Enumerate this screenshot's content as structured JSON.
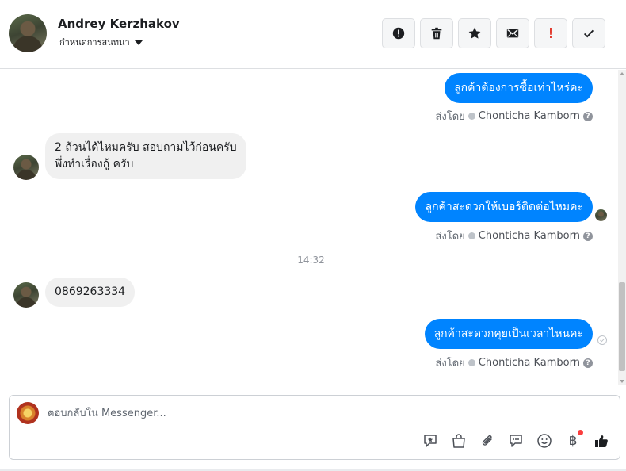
{
  "header": {
    "contact_name": "Andrey Kerzhakov",
    "status_label": "กำหนดการสนทนา",
    "actions": [
      {
        "icon": "alert-circle-icon",
        "name": "mark-spam-button"
      },
      {
        "icon": "trash-icon",
        "name": "delete-button"
      },
      {
        "icon": "star-icon",
        "name": "star-button"
      },
      {
        "icon": "envelope-icon",
        "name": "mark-unread-button"
      },
      {
        "icon": "exclamation-icon",
        "name": "follow-up-button",
        "glyph": "!"
      },
      {
        "icon": "check-icon",
        "name": "mark-done-button"
      }
    ]
  },
  "messages": [
    {
      "direction": "out",
      "text": "ลูกค้าต้องการซื้อเท่าไหร่คะ",
      "sent_by_prefix": "ส่งโดย",
      "sent_by": "Chonticha Kamborn",
      "help": "?"
    },
    {
      "direction": "in",
      "lines": [
        "2 ถ้วนได้ไหมครับ  สอบถามไว้ก่อนครับ",
        "พึ่งทำเรื่องกู้ ครับ"
      ]
    },
    {
      "direction": "out",
      "text": "ลูกค้าสะดวกให้เบอร์ติดต่อไหมคะ",
      "sent_by_prefix": "ส่งโดย",
      "sent_by": "Chonticha Kamborn",
      "help": "?"
    },
    {
      "direction": "time",
      "text": "14:32"
    },
    {
      "direction": "in",
      "lines": [
        "0869263334"
      ]
    },
    {
      "direction": "out",
      "text": "ลูกค้าสะดวกคุยเป็นเวลาไหนคะ",
      "sent_by_prefix": "ส่งโดย",
      "sent_by": "Chonticha Kamborn",
      "help": "?"
    }
  ],
  "composer": {
    "placeholder": "ตอบกลับใน Messenger...",
    "baht_glyph": "฿",
    "tools": [
      "saved-reply-icon",
      "shop-bag-icon",
      "attachment-icon",
      "chat-bubble-icon",
      "emoji-icon",
      "baht-icon",
      "thumbs-up-icon"
    ]
  },
  "colors": {
    "accent": "#0084ff",
    "incoming_bubble": "#f0f0f0",
    "notification": "#fa3e3e"
  }
}
